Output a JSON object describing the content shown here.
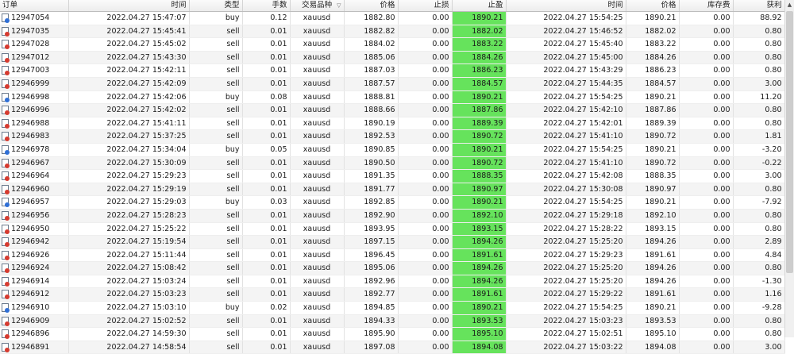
{
  "columns": {
    "order": "订单",
    "open_time": "时间",
    "type": "类型",
    "volume": "手数",
    "symbol": "交易品种",
    "open_price": "价格",
    "sl": "止损",
    "tp": "止盈",
    "close_time": "时间",
    "close_price": "价格",
    "swap": "库存费",
    "profit": "获利"
  },
  "sort_indicator": "▽",
  "rows": [
    {
      "order": "12947054",
      "open_time": "2022.04.27 15:47:07",
      "type": "buy",
      "volume": "0.12",
      "symbol": "xauusd",
      "open_price": "1882.80",
      "sl": "0.00",
      "tp": "1890.21",
      "close_time": "2022.04.27 15:54:25",
      "close_price": "1890.21",
      "swap": "0.00",
      "profit": "88.92"
    },
    {
      "order": "12947035",
      "open_time": "2022.04.27 15:45:41",
      "type": "sell",
      "volume": "0.01",
      "symbol": "xauusd",
      "open_price": "1882.82",
      "sl": "0.00",
      "tp": "1882.02",
      "close_time": "2022.04.27 15:46:52",
      "close_price": "1882.02",
      "swap": "0.00",
      "profit": "0.80"
    },
    {
      "order": "12947028",
      "open_time": "2022.04.27 15:45:02",
      "type": "sell",
      "volume": "0.01",
      "symbol": "xauusd",
      "open_price": "1884.02",
      "sl": "0.00",
      "tp": "1883.22",
      "close_time": "2022.04.27 15:45:40",
      "close_price": "1883.22",
      "swap": "0.00",
      "profit": "0.80"
    },
    {
      "order": "12947012",
      "open_time": "2022.04.27 15:43:30",
      "type": "sell",
      "volume": "0.01",
      "symbol": "xauusd",
      "open_price": "1885.06",
      "sl": "0.00",
      "tp": "1884.26",
      "close_time": "2022.04.27 15:45:00",
      "close_price": "1884.26",
      "swap": "0.00",
      "profit": "0.80"
    },
    {
      "order": "12947003",
      "open_time": "2022.04.27 15:42:11",
      "type": "sell",
      "volume": "0.01",
      "symbol": "xauusd",
      "open_price": "1887.03",
      "sl": "0.00",
      "tp": "1886.23",
      "close_time": "2022.04.27 15:43:29",
      "close_price": "1886.23",
      "swap": "0.00",
      "profit": "0.80"
    },
    {
      "order": "12946999",
      "open_time": "2022.04.27 15:42:09",
      "type": "sell",
      "volume": "0.01",
      "symbol": "xauusd",
      "open_price": "1887.57",
      "sl": "0.00",
      "tp": "1884.57",
      "close_time": "2022.04.27 15:44:35",
      "close_price": "1884.57",
      "swap": "0.00",
      "profit": "3.00"
    },
    {
      "order": "12946998",
      "open_time": "2022.04.27 15:42:06",
      "type": "buy",
      "volume": "0.08",
      "symbol": "xauusd",
      "open_price": "1888.81",
      "sl": "0.00",
      "tp": "1890.21",
      "close_time": "2022.04.27 15:54:25",
      "close_price": "1890.21",
      "swap": "0.00",
      "profit": "11.20"
    },
    {
      "order": "12946996",
      "open_time": "2022.04.27 15:42:02",
      "type": "sell",
      "volume": "0.01",
      "symbol": "xauusd",
      "open_price": "1888.66",
      "sl": "0.00",
      "tp": "1887.86",
      "close_time": "2022.04.27 15:42:10",
      "close_price": "1887.86",
      "swap": "0.00",
      "profit": "0.80"
    },
    {
      "order": "12946988",
      "open_time": "2022.04.27 15:41:11",
      "type": "sell",
      "volume": "0.01",
      "symbol": "xauusd",
      "open_price": "1890.19",
      "sl": "0.00",
      "tp": "1889.39",
      "close_time": "2022.04.27 15:42:01",
      "close_price": "1889.39",
      "swap": "0.00",
      "profit": "0.80"
    },
    {
      "order": "12946983",
      "open_time": "2022.04.27 15:37:25",
      "type": "sell",
      "volume": "0.01",
      "symbol": "xauusd",
      "open_price": "1892.53",
      "sl": "0.00",
      "tp": "1890.72",
      "close_time": "2022.04.27 15:41:10",
      "close_price": "1890.72",
      "swap": "0.00",
      "profit": "1.81"
    },
    {
      "order": "12946978",
      "open_time": "2022.04.27 15:34:04",
      "type": "buy",
      "volume": "0.05",
      "symbol": "xauusd",
      "open_price": "1890.85",
      "sl": "0.00",
      "tp": "1890.21",
      "close_time": "2022.04.27 15:54:25",
      "close_price": "1890.21",
      "swap": "0.00",
      "profit": "-3.20"
    },
    {
      "order": "12946967",
      "open_time": "2022.04.27 15:30:09",
      "type": "sell",
      "volume": "0.01",
      "symbol": "xauusd",
      "open_price": "1890.50",
      "sl": "0.00",
      "tp": "1890.72",
      "close_time": "2022.04.27 15:41:10",
      "close_price": "1890.72",
      "swap": "0.00",
      "profit": "-0.22"
    },
    {
      "order": "12946964",
      "open_time": "2022.04.27 15:29:23",
      "type": "sell",
      "volume": "0.01",
      "symbol": "xauusd",
      "open_price": "1891.35",
      "sl": "0.00",
      "tp": "1888.35",
      "close_time": "2022.04.27 15:42:08",
      "close_price": "1888.35",
      "swap": "0.00",
      "profit": "3.00"
    },
    {
      "order": "12946960",
      "open_time": "2022.04.27 15:29:19",
      "type": "sell",
      "volume": "0.01",
      "symbol": "xauusd",
      "open_price": "1891.77",
      "sl": "0.00",
      "tp": "1890.97",
      "close_time": "2022.04.27 15:30:08",
      "close_price": "1890.97",
      "swap": "0.00",
      "profit": "0.80"
    },
    {
      "order": "12946957",
      "open_time": "2022.04.27 15:29:03",
      "type": "buy",
      "volume": "0.03",
      "symbol": "xauusd",
      "open_price": "1892.85",
      "sl": "0.00",
      "tp": "1890.21",
      "close_time": "2022.04.27 15:54:25",
      "close_price": "1890.21",
      "swap": "0.00",
      "profit": "-7.92"
    },
    {
      "order": "12946956",
      "open_time": "2022.04.27 15:28:23",
      "type": "sell",
      "volume": "0.01",
      "symbol": "xauusd",
      "open_price": "1892.90",
      "sl": "0.00",
      "tp": "1892.10",
      "close_time": "2022.04.27 15:29:18",
      "close_price": "1892.10",
      "swap": "0.00",
      "profit": "0.80"
    },
    {
      "order": "12946950",
      "open_time": "2022.04.27 15:25:22",
      "type": "sell",
      "volume": "0.01",
      "symbol": "xauusd",
      "open_price": "1893.95",
      "sl": "0.00",
      "tp": "1893.15",
      "close_time": "2022.04.27 15:28:22",
      "close_price": "1893.15",
      "swap": "0.00",
      "profit": "0.80"
    },
    {
      "order": "12946942",
      "open_time": "2022.04.27 15:19:54",
      "type": "sell",
      "volume": "0.01",
      "symbol": "xauusd",
      "open_price": "1897.15",
      "sl": "0.00",
      "tp": "1894.26",
      "close_time": "2022.04.27 15:25:20",
      "close_price": "1894.26",
      "swap": "0.00",
      "profit": "2.89"
    },
    {
      "order": "12946926",
      "open_time": "2022.04.27 15:11:44",
      "type": "sell",
      "volume": "0.01",
      "symbol": "xauusd",
      "open_price": "1896.45",
      "sl": "0.00",
      "tp": "1891.61",
      "close_time": "2022.04.27 15:29:23",
      "close_price": "1891.61",
      "swap": "0.00",
      "profit": "4.84"
    },
    {
      "order": "12946924",
      "open_time": "2022.04.27 15:08:42",
      "type": "sell",
      "volume": "0.01",
      "symbol": "xauusd",
      "open_price": "1895.06",
      "sl": "0.00",
      "tp": "1894.26",
      "close_time": "2022.04.27 15:25:20",
      "close_price": "1894.26",
      "swap": "0.00",
      "profit": "0.80"
    },
    {
      "order": "12946914",
      "open_time": "2022.04.27 15:03:24",
      "type": "sell",
      "volume": "0.01",
      "symbol": "xauusd",
      "open_price": "1892.96",
      "sl": "0.00",
      "tp": "1894.26",
      "close_time": "2022.04.27 15:25:20",
      "close_price": "1894.26",
      "swap": "0.00",
      "profit": "-1.30"
    },
    {
      "order": "12946912",
      "open_time": "2022.04.27 15:03:23",
      "type": "sell",
      "volume": "0.01",
      "symbol": "xauusd",
      "open_price": "1892.77",
      "sl": "0.00",
      "tp": "1891.61",
      "close_time": "2022.04.27 15:29:22",
      "close_price": "1891.61",
      "swap": "0.00",
      "profit": "1.16"
    },
    {
      "order": "12946910",
      "open_time": "2022.04.27 15:03:10",
      "type": "buy",
      "volume": "0.02",
      "symbol": "xauusd",
      "open_price": "1894.85",
      "sl": "0.00",
      "tp": "1890.21",
      "close_time": "2022.04.27 15:54:25",
      "close_price": "1890.21",
      "swap": "0.00",
      "profit": "-9.28"
    },
    {
      "order": "12946909",
      "open_time": "2022.04.27 15:02:52",
      "type": "sell",
      "volume": "0.01",
      "symbol": "xauusd",
      "open_price": "1894.33",
      "sl": "0.00",
      "tp": "1893.53",
      "close_time": "2022.04.27 15:03:23",
      "close_price": "1893.53",
      "swap": "0.00",
      "profit": "0.80"
    },
    {
      "order": "12946896",
      "open_time": "2022.04.27 14:59:30",
      "type": "sell",
      "volume": "0.01",
      "symbol": "xauusd",
      "open_price": "1895.90",
      "sl": "0.00",
      "tp": "1895.10",
      "close_time": "2022.04.27 15:02:51",
      "close_price": "1895.10",
      "swap": "0.00",
      "profit": "0.80"
    },
    {
      "order": "12946891",
      "open_time": "2022.04.27 14:58:54",
      "type": "sell",
      "volume": "0.01",
      "symbol": "xauusd",
      "open_price": "1897.08",
      "sl": "0.00",
      "tp": "1894.08",
      "close_time": "2022.04.27 15:03:22",
      "close_price": "1894.08",
      "swap": "0.00",
      "profit": "3.00"
    }
  ]
}
